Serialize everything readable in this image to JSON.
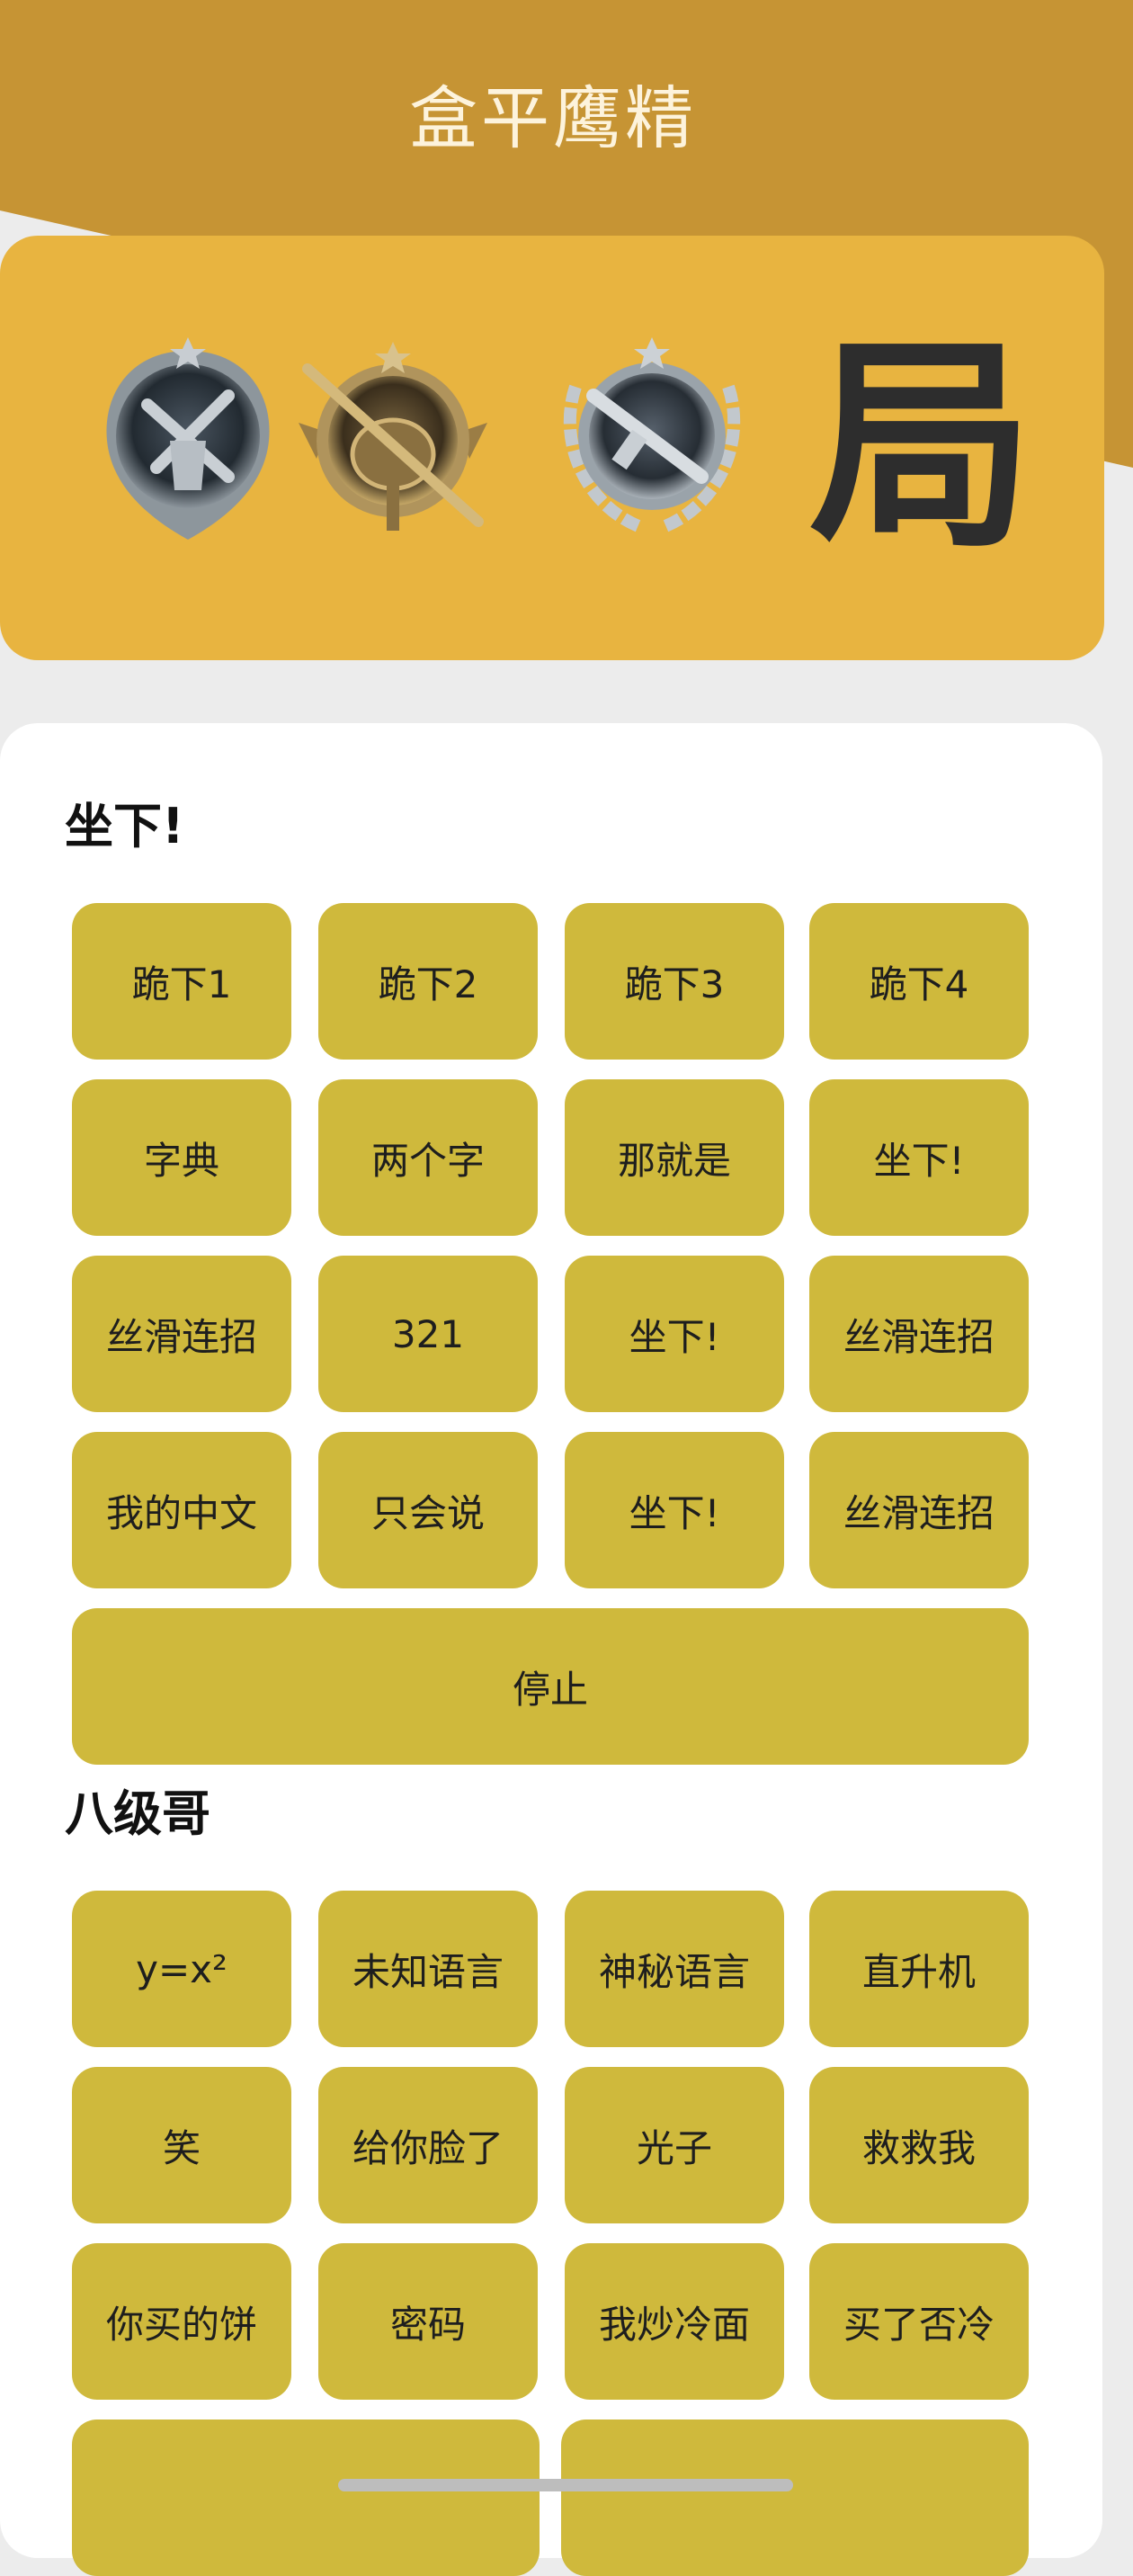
{
  "app": {
    "title": "盒平鹰精"
  },
  "banner": {
    "char": "局",
    "medals": [
      "medal-badge-icon",
      "medal-badge-icon",
      "medal-badge-icon"
    ]
  },
  "sections": [
    {
      "title": "坐下!",
      "buttons": [
        "跪下1",
        "跪下2",
        "跪下3",
        "跪下4",
        "字典",
        "两个字",
        "那就是",
        "坐下!",
        "丝滑连招",
        "321",
        "坐下!",
        "丝滑连招",
        "我的中文",
        "只会说",
        "坐下!",
        "丝滑连招"
      ],
      "wide_button": "停止"
    },
    {
      "title": "八级哥",
      "buttons": [
        "y=x²",
        "未知语言",
        "神秘语言",
        "直升机",
        "笑",
        "给你脸了",
        "光子",
        "救救我",
        "你买的饼",
        "密码",
        "我炒冷面",
        "买了否冷"
      ],
      "partial_buttons": [
        "",
        ""
      ]
    }
  ],
  "colors": {
    "header": "#c69434",
    "banner": "#e8b440",
    "button": "#cfb93c",
    "background": "#ececec"
  }
}
